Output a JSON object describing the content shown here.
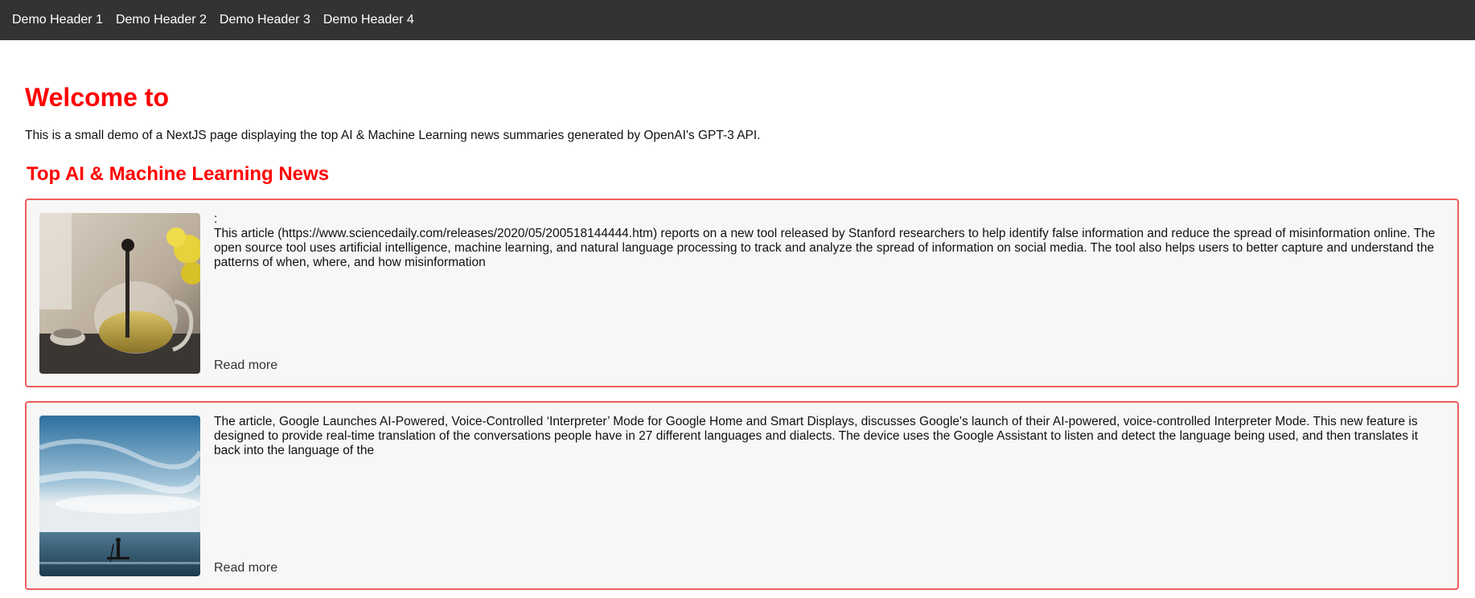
{
  "nav": {
    "items": [
      {
        "label": "Demo Header 1"
      },
      {
        "label": "Demo Header 2"
      },
      {
        "label": "Demo Header 3"
      },
      {
        "label": "Demo Header 4"
      }
    ]
  },
  "main": {
    "title": "Welcome to",
    "intro": "This is a small demo of a NextJS page displaying the top AI & Machine Learning news summaries generated by OpenAI's GPT-3 API.",
    "news_heading": "Top AI & Machine Learning News"
  },
  "articles": [
    {
      "title": ":",
      "summary": "This article (https://www.sciencedaily.com/releases/2020/05/200518144444.htm) reports on a new tool released by Stanford researchers to help identify false information and reduce the spread of misinformation online. The open source tool uses artificial intelligence, machine learning, and natural language processing to track and analyze the spread of information on social media. The tool also helps users to better capture and understand the patterns of when, where, and how misinformation",
      "read_more": "Read more",
      "image_icon": "teapot-photo"
    },
    {
      "title": "",
      "summary": "The article, Google Launches AI-Powered, Voice-Controlled ‘Interpreter’ Mode for Google Home and Smart Displays, discusses Google's launch of their AI-powered, voice-controlled Interpreter Mode. This new feature is designed to provide real-time translation of the conversations people have in 27 different languages and dialects. The device uses the Google Assistant to listen and detect the language being used, and then translates it back into the language of the",
      "read_more": "Read more",
      "image_icon": "sea-surfer-photo"
    }
  ],
  "colors": {
    "nav_bg": "#333333",
    "accent": "#ff0000",
    "card_border": "#f25c5c",
    "card_bg": "#f7f7f7"
  }
}
